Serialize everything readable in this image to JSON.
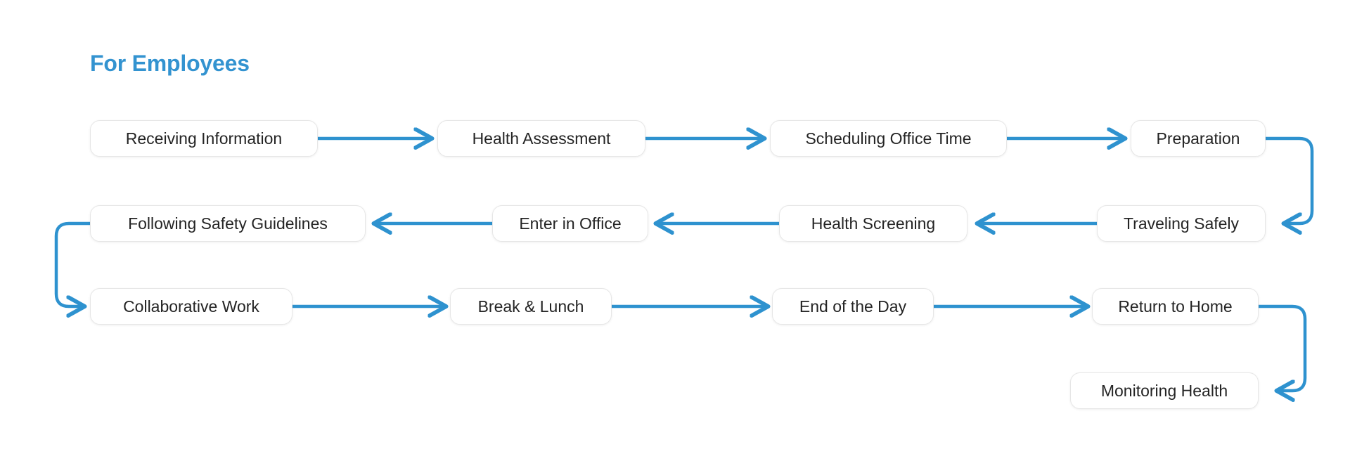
{
  "diagram": {
    "title": "For Employees",
    "accent_color": "#2e92cf",
    "title_color": "#3393d0",
    "node_border_color": "#e6e6e6",
    "node_text_color": "#242424",
    "background_color": "#ffffff"
  },
  "rows": [
    {
      "direction": "left-to-right",
      "nodes": [
        {
          "label": "Receiving Information"
        },
        {
          "label": "Health Assessment"
        },
        {
          "label": "Scheduling Office Time"
        },
        {
          "label": "Preparation"
        }
      ]
    },
    {
      "direction": "right-to-left",
      "nodes": [
        {
          "label": "Following Safety Guidelines"
        },
        {
          "label": "Enter in Office"
        },
        {
          "label": "Health Screening"
        },
        {
          "label": "Traveling Safely"
        }
      ]
    },
    {
      "direction": "left-to-right",
      "nodes": [
        {
          "label": "Collaborative Work"
        },
        {
          "label": "Break & Lunch"
        },
        {
          "label": "End of the Day"
        },
        {
          "label": "Return to Home"
        }
      ]
    },
    {
      "direction": "terminal",
      "nodes": [
        {
          "label": "Monitoring Health"
        }
      ]
    }
  ],
  "flow_order": [
    "Receiving Information",
    "Health Assessment",
    "Scheduling Office Time",
    "Preparation",
    "Traveling Safely",
    "Health Screening",
    "Enter in Office",
    "Following Safety Guidelines",
    "Collaborative Work",
    "Break & Lunch",
    "End of the Day",
    "Return to Home",
    "Monitoring Health"
  ],
  "connectors": [
    {
      "from": "Receiving Information",
      "to": "Health Assessment",
      "kind": "straight-right"
    },
    {
      "from": "Health Assessment",
      "to": "Scheduling Office Time",
      "kind": "straight-right"
    },
    {
      "from": "Scheduling Office Time",
      "to": "Preparation",
      "kind": "straight-right"
    },
    {
      "from": "Preparation",
      "to": "Traveling Safely",
      "kind": "wrap-right-down"
    },
    {
      "from": "Traveling Safely",
      "to": "Health Screening",
      "kind": "straight-left"
    },
    {
      "from": "Health Screening",
      "to": "Enter in Office",
      "kind": "straight-left"
    },
    {
      "from": "Enter in Office",
      "to": "Following Safety Guidelines",
      "kind": "straight-left"
    },
    {
      "from": "Following Safety Guidelines",
      "to": "Collaborative Work",
      "kind": "wrap-left-down"
    },
    {
      "from": "Collaborative Work",
      "to": "Break & Lunch",
      "kind": "straight-right"
    },
    {
      "from": "Break & Lunch",
      "to": "End of the Day",
      "kind": "straight-right"
    },
    {
      "from": "End of the Day",
      "to": "Return to Home",
      "kind": "straight-right"
    },
    {
      "from": "Return to Home",
      "to": "Monitoring Health",
      "kind": "wrap-right-down"
    }
  ]
}
